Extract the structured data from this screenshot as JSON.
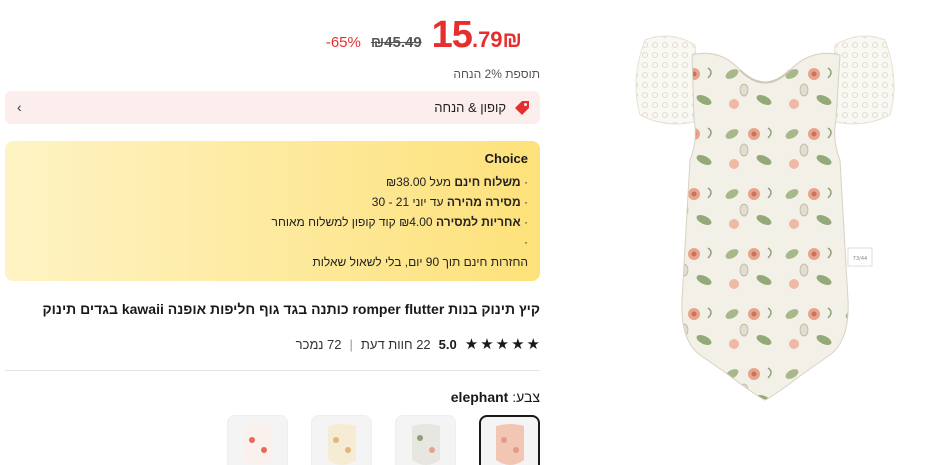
{
  "price": {
    "currency": "₪",
    "integer": "15",
    "decimal": ".79",
    "original": "₪45.49",
    "discount": "-65%"
  },
  "extra_discount": "תוספת 2% הנחה",
  "coupon": {
    "label": "קופון & הנחה"
  },
  "choice": {
    "title": "Choice",
    "lines": [
      {
        "bullet": "·",
        "strong": "משלוח חינם",
        "text": "מעל ₪38.00"
      },
      {
        "bullet": "·",
        "strong": "מסירה מהירה",
        "text": "עד יוני 21 - 30"
      },
      {
        "bullet": "·",
        "strong": "אחריות למסירה",
        "text": "₪4.00 קוד קופון למשלוח מאוחר"
      },
      {
        "bullet": "·",
        "strong": "",
        "text": ""
      },
      {
        "bullet": "",
        "strong": "",
        "text": "החזרות חינם תוך 90 יום, בלי לשאול שאלות"
      }
    ]
  },
  "product": {
    "title": "קיץ תינוק בנות romper flutter כותנה בגד גוף חליפות אופנה kawaii בגדים תינוק",
    "rating": "5.0",
    "reviews": "22 חוות דעת",
    "sold": "72 נמכר"
  },
  "color": {
    "label": "צבע:",
    "value": "elephant"
  },
  "colors": {
    "accent": "#e62e2e",
    "choice_gradient_start": "#fef3c4",
    "choice_gradient_end": "#fde17a",
    "coupon_bg": "#fdeeee"
  },
  "icons": [
    "tag-icon",
    "chevron-right-icon",
    "star-icon"
  ]
}
